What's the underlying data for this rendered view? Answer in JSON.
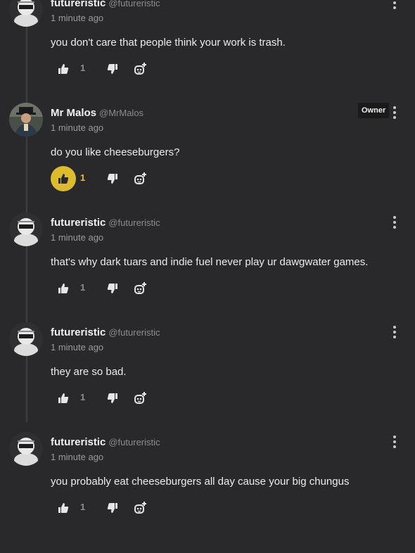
{
  "comments": [
    {
      "name": "futureristic",
      "handle": "@futureristic",
      "time": "1 minute ago",
      "text": "you don't care that people think your work is trash.",
      "likes": "1",
      "liked": false,
      "owner": false
    },
    {
      "name": "Mr Malos",
      "handle": "@MrMalos",
      "time": "1 minute ago",
      "text": "do you like cheeseburgers?",
      "likes": "1",
      "liked": true,
      "owner": true,
      "owner_label": "Owner"
    },
    {
      "name": "futureristic",
      "handle": "@futureristic",
      "time": "1 minute ago",
      "text": "that's why dark tuars and indie fuel never play ur dawgwater games.",
      "likes": "1",
      "liked": false,
      "owner": false
    },
    {
      "name": "futureristic",
      "handle": "@futureristic",
      "time": "1 minute ago",
      "text": "they are so bad.",
      "likes": "1",
      "liked": false,
      "owner": false
    },
    {
      "name": "futureristic",
      "handle": "@futureristic",
      "time": "1 minute ago",
      "text": "you probably eat cheeseburgers all day cause your big chungus",
      "likes": "1",
      "liked": false,
      "owner": false
    }
  ],
  "icons": {
    "like": "thumbs-up-icon",
    "dislike": "thumbs-down-icon",
    "reply": "reply-add-icon",
    "menu": "more-vertical-icon"
  },
  "colors": {
    "background": "#29292b",
    "liked_accent": "#dcbb2e"
  }
}
